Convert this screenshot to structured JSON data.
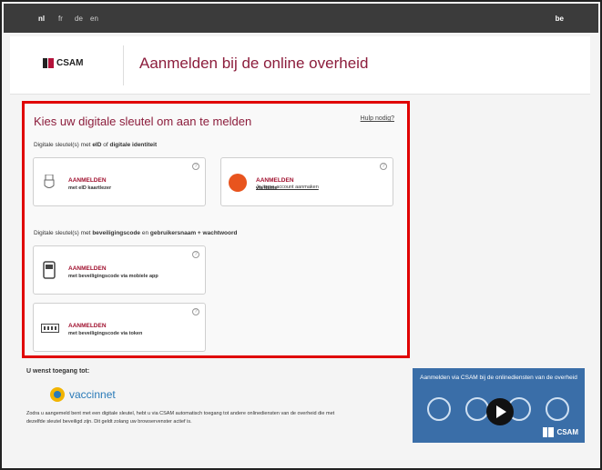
{
  "topbar": {
    "languages": [
      "nl",
      "fr",
      "de",
      "en"
    ],
    "region": "be"
  },
  "header": {
    "logo_text": "CSAM",
    "title": "Aanmelden bij de online overheid"
  },
  "login_panel": {
    "title": "Kies uw digitale sleutel om aan te melden",
    "help_link": "Hulp nodig?",
    "section1": {
      "prefix": "Digitale sleutel(s) met ",
      "b1": "eID",
      "mid": " of ",
      "b2": "digitale identiteit"
    },
    "section2": {
      "prefix": "Digitale sleutel(s) met ",
      "b1": "beveiligingscode",
      "mid": " en ",
      "b2": "gebruikersnaam + wachtwoord"
    },
    "cards": {
      "eid": {
        "title": "AANMELDEN",
        "sub": "met eID kaartlezer",
        "icon": "card-reader-icon"
      },
      "itsme": {
        "title": "AANMELDEN",
        "sub": "via itsme",
        "icon": "itsme-icon"
      },
      "app": {
        "title": "AANMELDEN",
        "sub": "met beveiligingscode via mobiele app",
        "icon": "mobile-app-icon"
      },
      "token": {
        "title": "AANMELDEN",
        "sub": "met beveiligingscode via token",
        "icon": "token-icon"
      }
    },
    "help_icon": "?",
    "itsme_account_link": "Je itsme-account aanmaken"
  },
  "access": {
    "title": "U wenst toegang tot:",
    "service_name": "vaccinnet",
    "body": "Zodra u aangemeld bent met een digitale sleutel, hebt u via CSAM automatisch toegang tot andere onlinediensten van de overheid die met dezelfde sleutel beveiligd zijn. Dit geldt zolang uw browservenster actief is."
  },
  "video": {
    "caption": "Aanmelden via CSAM bij de onlinediensten van de overheid",
    "logo_text": "CSAM"
  },
  "colors": {
    "accent": "#8c1d3c",
    "highlight": "#e00000",
    "video_bg": "#3a6ea8"
  }
}
